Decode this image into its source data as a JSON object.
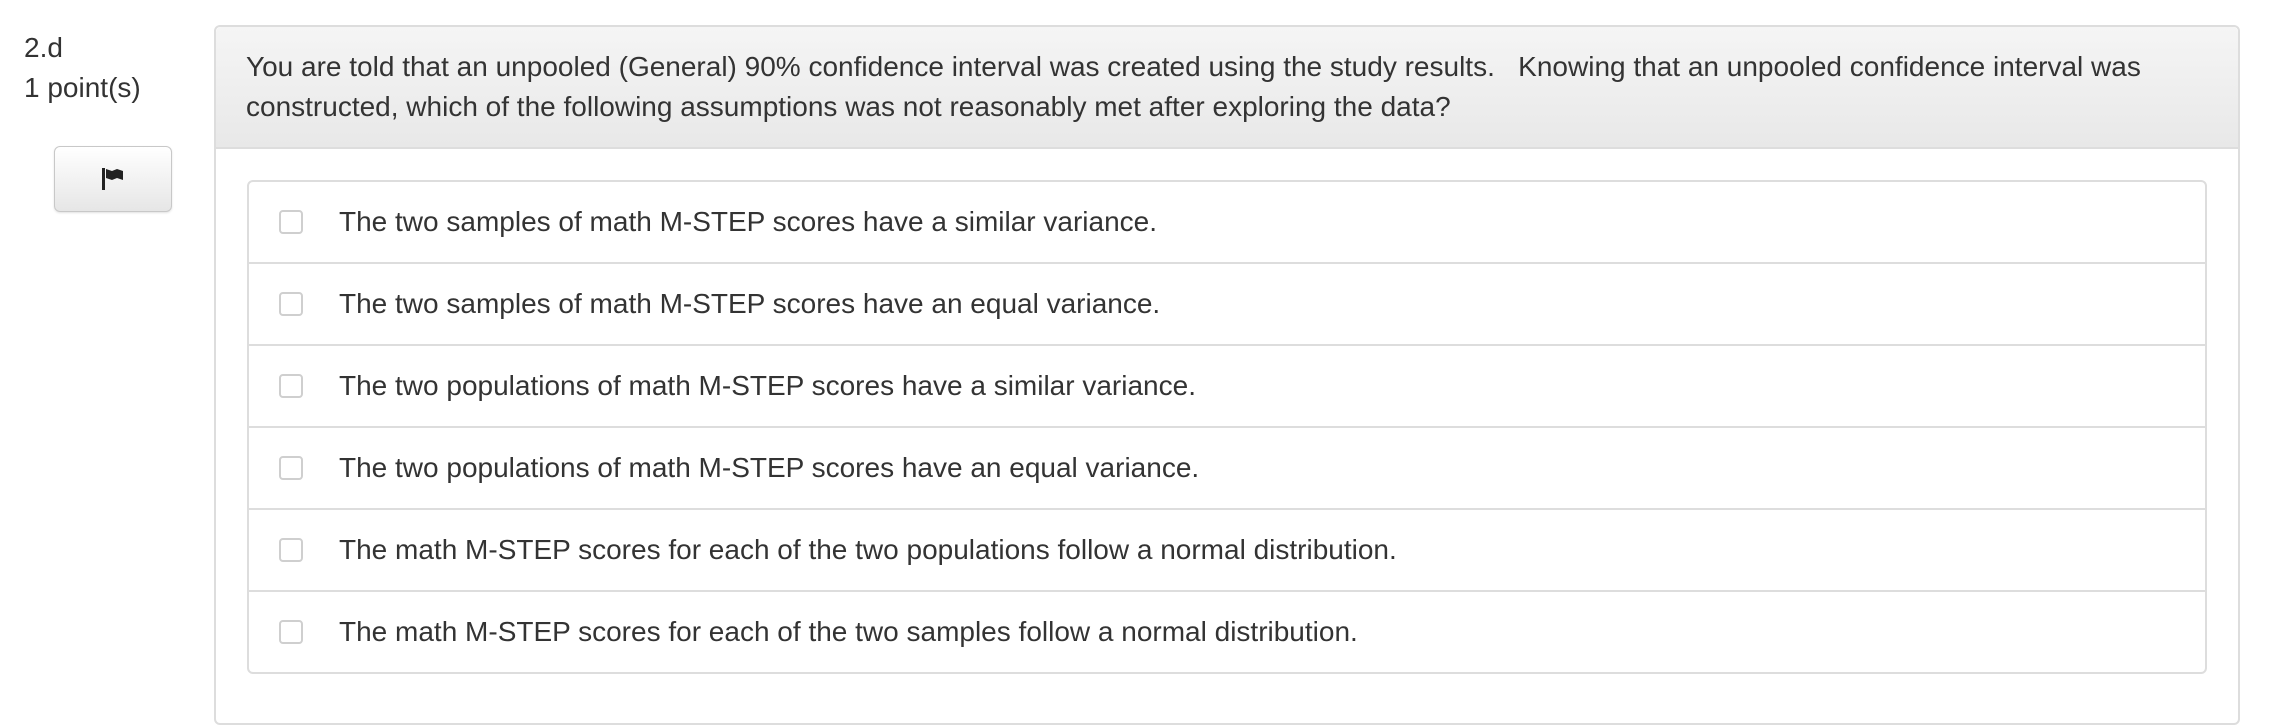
{
  "question": {
    "number": "2.d",
    "points": "1 point(s)",
    "text": "You are told that an unpooled (General) 90% confidence interval was created using the study results.   Knowing that an unpooled confidence interval was constructed, which of the following assumptions was not reasonably met after exploring the data?"
  },
  "flag_button": {
    "icon": "flag-icon"
  },
  "options": [
    {
      "label": "The two samples of math M-STEP scores have a similar variance.",
      "checked": false
    },
    {
      "label": "The two samples of math M-STEP scores have an equal variance.",
      "checked": false
    },
    {
      "label": "The two populations of math M-STEP scores have a similar variance.",
      "checked": false
    },
    {
      "label": "The two populations of math M-STEP scores have an equal variance.",
      "checked": false
    },
    {
      "label": "The math M-STEP scores for each of the two populations follow a normal distribution.",
      "checked": false
    },
    {
      "label": "The math M-STEP scores for each of the two samples follow a normal distribution.",
      "checked": false
    }
  ]
}
